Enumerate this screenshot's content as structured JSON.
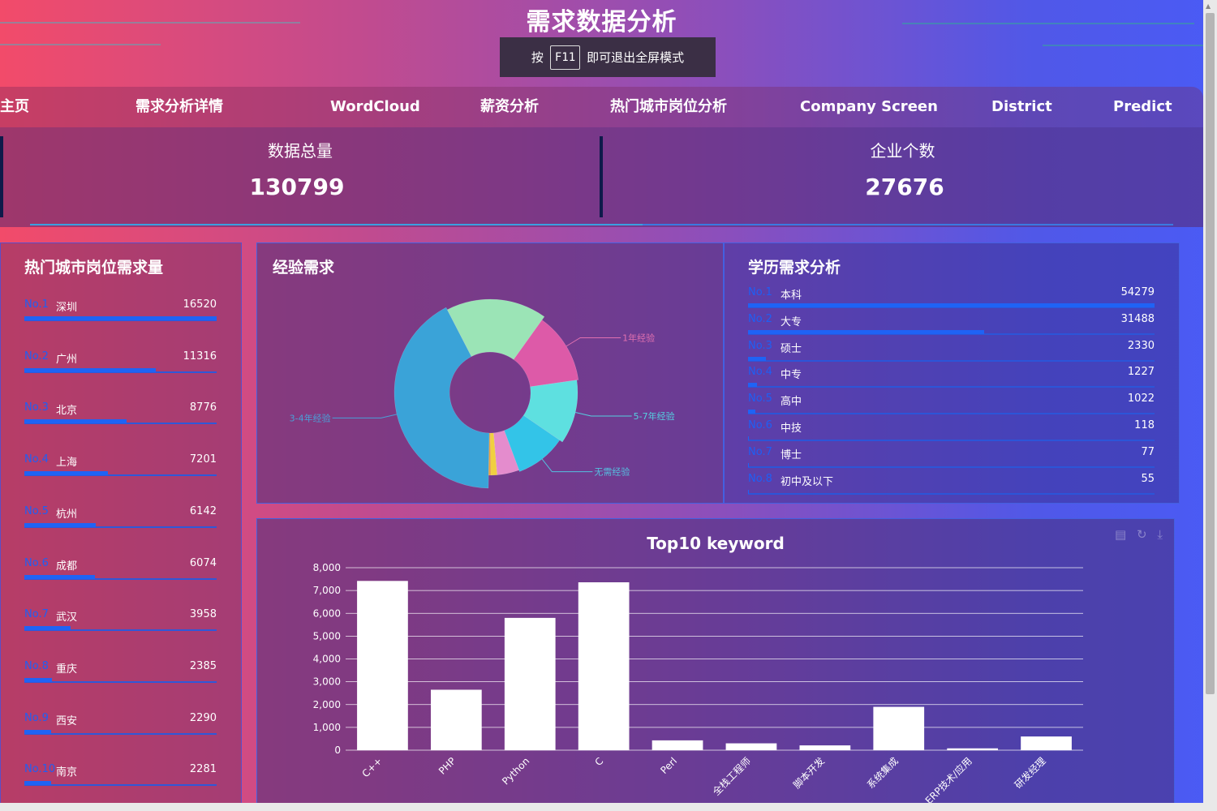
{
  "header": {
    "title": "需求数据分析",
    "fullscreen_notice": {
      "prefix": "按",
      "key": "F11",
      "suffix": "即可退出全屏模式"
    }
  },
  "nav": {
    "items": [
      {
        "label": "主页"
      },
      {
        "label": "需求分析详情"
      },
      {
        "label": "WordCloud"
      },
      {
        "label": "薪资分析"
      },
      {
        "label": "热门城市岗位分析"
      },
      {
        "label": "Company Screen"
      },
      {
        "label": "District"
      },
      {
        "label": "Predict"
      }
    ]
  },
  "stats": {
    "total": {
      "label": "数据总量",
      "value": "130799"
    },
    "companies": {
      "label": "企业个数",
      "value": "27676"
    }
  },
  "city_ranking": {
    "title": "热门城市岗位需求量",
    "items": [
      {
        "no": "No.1",
        "city": "深圳",
        "value": 16520
      },
      {
        "no": "No.2",
        "city": "广州",
        "value": 11316
      },
      {
        "no": "No.3",
        "city": "北京",
        "value": 8776
      },
      {
        "no": "No.4",
        "city": "上海",
        "value": 7201
      },
      {
        "no": "No.5",
        "city": "杭州",
        "value": 6142
      },
      {
        "no": "No.6",
        "city": "成都",
        "value": 6074
      },
      {
        "no": "No.7",
        "city": "武汉",
        "value": 3958
      },
      {
        "no": "No.8",
        "city": "重庆",
        "value": 2385
      },
      {
        "no": "No.9",
        "city": "西安",
        "value": 2290
      },
      {
        "no": "No.10",
        "city": "南京",
        "value": 2281
      }
    ]
  },
  "experience": {
    "title": "经验需求",
    "colors": [
      "#3aa3d8",
      "#9be4b6",
      "#dd5aa8",
      "#5ee0e0",
      "#33c4e8",
      "#e48ccd",
      "#f0d040",
      "#e8a040"
    ]
  },
  "education": {
    "title": "学历需求分析",
    "items": [
      {
        "no": "No.1",
        "label": "本科",
        "value": 54279
      },
      {
        "no": "No.2",
        "label": "大专",
        "value": 31488
      },
      {
        "no": "No.3",
        "label": "硕士",
        "value": 2330
      },
      {
        "no": "No.4",
        "label": "中专",
        "value": 1227
      },
      {
        "no": "No.5",
        "label": "高中",
        "value": 1022
      },
      {
        "no": "No.6",
        "label": "中技",
        "value": 118
      },
      {
        "no": "No.7",
        "label": "博士",
        "value": 77
      },
      {
        "no": "No.8",
        "label": "初中及以下",
        "value": 55
      }
    ]
  },
  "chart_data": [
    {
      "type": "pie",
      "title": "经验需求",
      "slices": [
        {
          "label": "3-4年经验",
          "value": 41
        },
        {
          "label": "",
          "value": 17
        },
        {
          "label": "1年经验",
          "value": 12.5
        },
        {
          "label": "5-7年经验",
          "value": 11.5
        },
        {
          "label": "无需经验",
          "value": 9.5
        },
        {
          "label": "",
          "value": 4.2
        },
        {
          "label": "",
          "value": 1.2
        },
        {
          "label": "",
          "value": 0.4
        }
      ]
    },
    {
      "type": "bar",
      "title": "Top10 keyword",
      "categories": [
        "C++",
        "PHP",
        "Python",
        "C",
        "Perl",
        "全栈工程师",
        "脚本开发",
        "系统集成",
        "ERP技术/应用",
        "研发经理"
      ],
      "values": [
        7420,
        2650,
        5800,
        7360,
        430,
        300,
        210,
        1900,
        80,
        600
      ],
      "ylim": [
        0,
        8000
      ],
      "yticks": [
        "0",
        "1,000",
        "2,000",
        "3,000",
        "4,000",
        "5,000",
        "6,000",
        "7,000",
        "8,000"
      ],
      "bar_color": "#ffffff",
      "grid": true
    }
  ]
}
